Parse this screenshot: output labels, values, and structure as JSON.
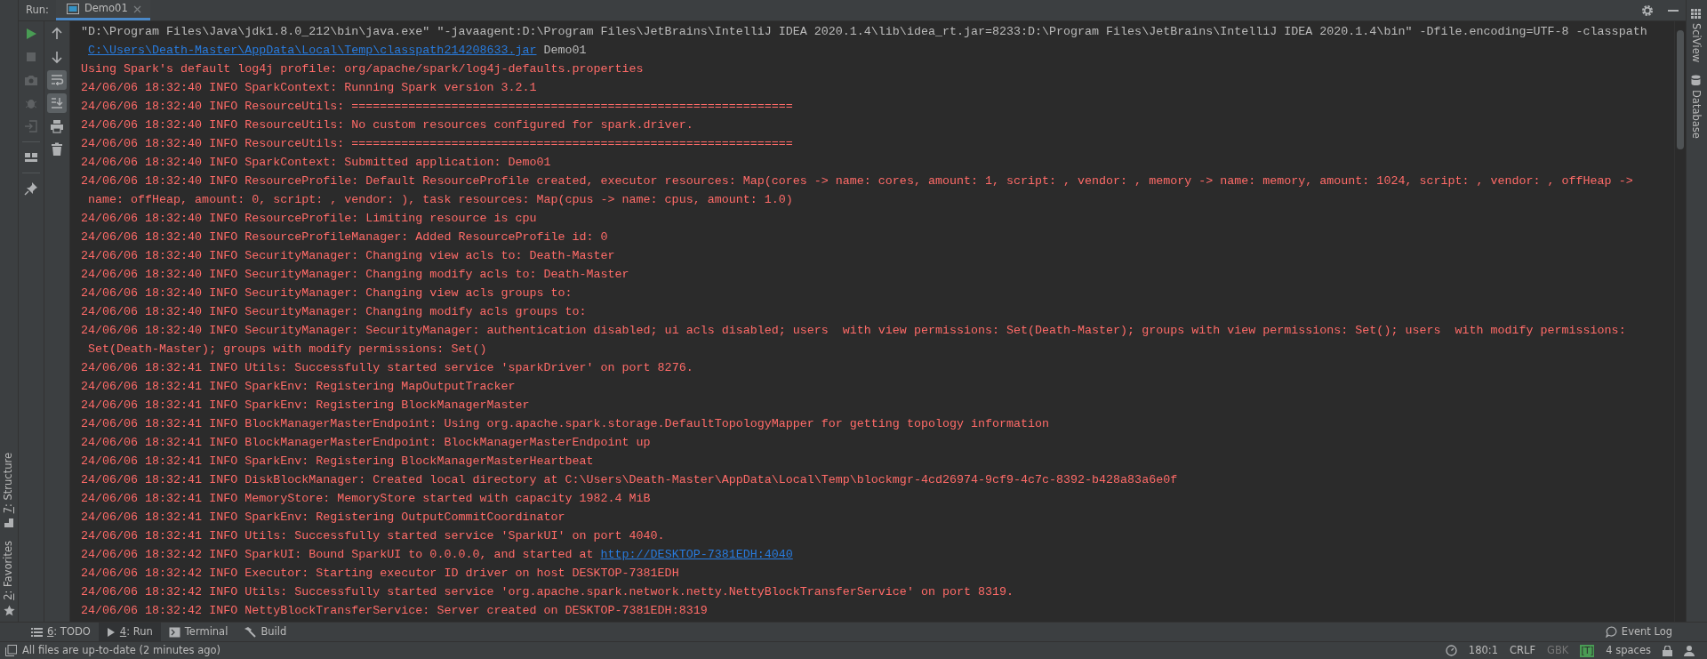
{
  "run_panel": {
    "label": "Run:",
    "tabs": [
      {
        "title": "Demo01",
        "selected": true
      }
    ]
  },
  "console_tools": [
    {
      "disabled": false
    },
    {
      "disabled": true
    },
    {
      "disabled": true
    },
    {
      "disabled": true
    },
    {
      "disabled": true
    },
    {
      "disabled": false
    },
    {
      "disabled": false
    }
  ],
  "output_tools": [
    {
      "toggled": false
    },
    {
      "toggled": false
    },
    {
      "toggled": true
    },
    {
      "toggled": true
    },
    {
      "toggled": false
    },
    {
      "toggled": false
    }
  ],
  "console": {
    "lines": [
      {
        "parts": [
          {
            "kind": "command",
            "text": "\"D:\\Program Files\\Java\\jdk1.8.0_212\\bin\\java.exe\" \"-javaagent:D:\\Program Files\\JetBrains\\IntelliJ IDEA 2020.1.4\\lib\\idea_rt.jar=8233:D:\\Program Files\\JetBrains\\IntelliJ IDEA 2020.1.4\\bin\" -Dfile.encoding=UTF-8 -classpath"
          }
        ]
      },
      {
        "continued": true,
        "parts": [
          {
            "kind": "link",
            "text": "C:\\Users\\Death-Master\\AppData\\Local\\Temp\\classpath214208633.jar"
          },
          {
            "kind": "command",
            "text": " Demo01"
          }
        ]
      },
      {
        "parts": [
          {
            "kind": "error",
            "text": "Using Spark's default log4j profile: org/apache/spark/log4j-defaults.properties"
          }
        ]
      },
      {
        "parts": [
          {
            "kind": "error",
            "text": "24/06/06 18:32:40 INFO SparkContext: Running Spark version 3.2.1"
          }
        ]
      },
      {
        "parts": [
          {
            "kind": "error",
            "text": "24/06/06 18:32:40 INFO ResourceUtils: =============================================================="
          }
        ]
      },
      {
        "parts": [
          {
            "kind": "error",
            "text": "24/06/06 18:32:40 INFO ResourceUtils: No custom resources configured for spark.driver."
          }
        ]
      },
      {
        "parts": [
          {
            "kind": "error",
            "text": "24/06/06 18:32:40 INFO ResourceUtils: =============================================================="
          }
        ]
      },
      {
        "parts": [
          {
            "kind": "error",
            "text": "24/06/06 18:32:40 INFO SparkContext: Submitted application: Demo01"
          }
        ]
      },
      {
        "parts": [
          {
            "kind": "error",
            "text": "24/06/06 18:32:40 INFO ResourceProfile: Default ResourceProfile created, executor resources: Map(cores -> name: cores, amount: 1, script: , vendor: , memory -> name: memory, amount: 1024, script: , vendor: , offHeap ->"
          }
        ]
      },
      {
        "continued": true,
        "parts": [
          {
            "kind": "error",
            "text": "name: offHeap, amount: 0, script: , vendor: ), task resources: Map(cpus -> name: cpus, amount: 1.0)"
          }
        ]
      },
      {
        "parts": [
          {
            "kind": "error",
            "text": "24/06/06 18:32:40 INFO ResourceProfile: Limiting resource is cpu"
          }
        ]
      },
      {
        "parts": [
          {
            "kind": "error",
            "text": "24/06/06 18:32:40 INFO ResourceProfileManager: Added ResourceProfile id: 0"
          }
        ]
      },
      {
        "parts": [
          {
            "kind": "error",
            "text": "24/06/06 18:32:40 INFO SecurityManager: Changing view acls to: Death-Master"
          }
        ]
      },
      {
        "parts": [
          {
            "kind": "error",
            "text": "24/06/06 18:32:40 INFO SecurityManager: Changing modify acls to: Death-Master"
          }
        ]
      },
      {
        "parts": [
          {
            "kind": "error",
            "text": "24/06/06 18:32:40 INFO SecurityManager: Changing view acls groups to: "
          }
        ]
      },
      {
        "parts": [
          {
            "kind": "error",
            "text": "24/06/06 18:32:40 INFO SecurityManager: Changing modify acls groups to: "
          }
        ]
      },
      {
        "parts": [
          {
            "kind": "error",
            "text": "24/06/06 18:32:40 INFO SecurityManager: SecurityManager: authentication disabled; ui acls disabled; users  with view permissions: Set(Death-Master); groups with view permissions: Set(); users  with modify permissions:"
          }
        ]
      },
      {
        "continued": true,
        "parts": [
          {
            "kind": "error",
            "text": "Set(Death-Master); groups with modify permissions: Set()"
          }
        ]
      },
      {
        "parts": [
          {
            "kind": "error",
            "text": "24/06/06 18:32:41 INFO Utils: Successfully started service 'sparkDriver' on port 8276."
          }
        ]
      },
      {
        "parts": [
          {
            "kind": "error",
            "text": "24/06/06 18:32:41 INFO SparkEnv: Registering MapOutputTracker"
          }
        ]
      },
      {
        "parts": [
          {
            "kind": "error",
            "text": "24/06/06 18:32:41 INFO SparkEnv: Registering BlockManagerMaster"
          }
        ]
      },
      {
        "parts": [
          {
            "kind": "error",
            "text": "24/06/06 18:32:41 INFO BlockManagerMasterEndpoint: Using org.apache.spark.storage.DefaultTopologyMapper for getting topology information"
          }
        ]
      },
      {
        "parts": [
          {
            "kind": "error",
            "text": "24/06/06 18:32:41 INFO BlockManagerMasterEndpoint: BlockManagerMasterEndpoint up"
          }
        ]
      },
      {
        "parts": [
          {
            "kind": "error",
            "text": "24/06/06 18:32:41 INFO SparkEnv: Registering BlockManagerMasterHeartbeat"
          }
        ]
      },
      {
        "parts": [
          {
            "kind": "error",
            "text": "24/06/06 18:32:41 INFO DiskBlockManager: Created local directory at C:\\Users\\Death-Master\\AppData\\Local\\Temp\\blockmgr-4cd26974-9cf9-4c7c-8392-b428a83a6e0f"
          }
        ]
      },
      {
        "parts": [
          {
            "kind": "error",
            "text": "24/06/06 18:32:41 INFO MemoryStore: MemoryStore started with capacity 1982.4 MiB"
          }
        ]
      },
      {
        "parts": [
          {
            "kind": "error",
            "text": "24/06/06 18:32:41 INFO SparkEnv: Registering OutputCommitCoordinator"
          }
        ]
      },
      {
        "parts": [
          {
            "kind": "error",
            "text": "24/06/06 18:32:41 INFO Utils: Successfully started service 'SparkUI' on port 4040."
          }
        ]
      },
      {
        "parts": [
          {
            "kind": "error",
            "text": "24/06/06 18:32:42 INFO SparkUI: Bound SparkUI to 0.0.0.0, and started at "
          },
          {
            "kind": "link",
            "text": "http://DESKTOP-7381EDH:4040"
          }
        ]
      },
      {
        "parts": [
          {
            "kind": "error",
            "text": "24/06/06 18:32:42 INFO Executor: Starting executor ID driver on host DESKTOP-7381EDH"
          }
        ]
      },
      {
        "parts": [
          {
            "kind": "error",
            "text": "24/06/06 18:32:42 INFO Utils: Successfully started service 'org.apache.spark.network.netty.NettyBlockTransferService' on port 8319."
          }
        ]
      },
      {
        "parts": [
          {
            "kind": "error",
            "text": "24/06/06 18:32:42 INFO NettyBlockTransferService: Server created on DESKTOP-7381EDH:8319"
          }
        ]
      }
    ]
  },
  "left_stripe": [
    {
      "label": "7: Structure",
      "mnemonic": true
    },
    {
      "label": "2: Favorites",
      "mnemonic": true
    }
  ],
  "right_stripe": [
    {
      "label": "SciView"
    },
    {
      "label": "Database"
    }
  ],
  "tool_windows": [
    {
      "label": "6: TODO",
      "mnemonic": true,
      "selected": false
    },
    {
      "label": "4: Run",
      "mnemonic": true,
      "selected": true
    },
    {
      "label": "Terminal",
      "mnemonic": false,
      "selected": false
    },
    {
      "label": "Build",
      "mnemonic": false,
      "selected": false
    }
  ],
  "event_log": "Event Log",
  "status_bar": {
    "message": "All files are up-to-date (2 minutes ago)",
    "items": [
      {
        "kind": "text",
        "text": "180:1",
        "disabled": false
      },
      {
        "kind": "text",
        "text": "CRLF",
        "disabled": false
      },
      {
        "kind": "text",
        "text": "GBK",
        "disabled": true
      },
      {
        "kind": "badge",
        "text": "[T]",
        "disabled": false
      },
      {
        "kind": "text",
        "text": "4 spaces",
        "disabled": false
      }
    ]
  }
}
